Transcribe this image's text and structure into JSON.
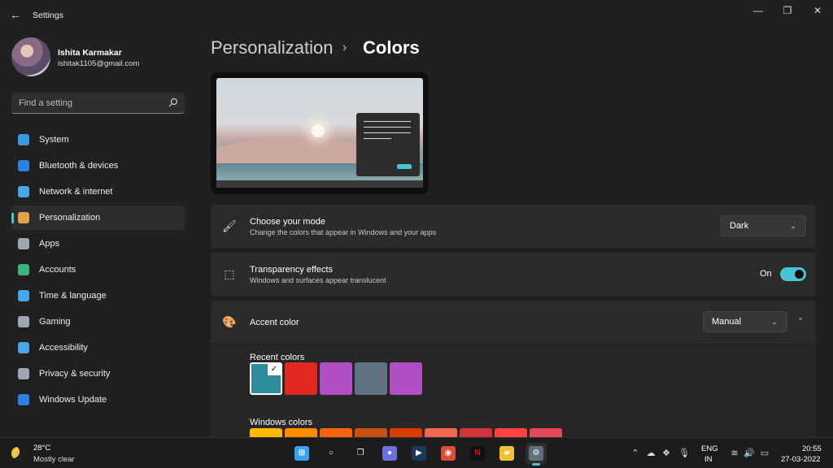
{
  "window": {
    "app_title": "Settings",
    "back_icon": "back-arrow-icon",
    "minimize_icon": "minimize-icon",
    "maximize_icon": "restore-icon",
    "close_icon": "close-icon"
  },
  "profile": {
    "name": "Ishita Karmakar",
    "email": "ishitak1105@gmail.com"
  },
  "search": {
    "placeholder": "Find a setting",
    "icon": "search-icon"
  },
  "sidebar": {
    "items": [
      {
        "label": "System",
        "icon": "system-icon",
        "color": "#3a9ae0",
        "active": false
      },
      {
        "label": "Bluetooth & devices",
        "icon": "bluetooth-icon",
        "color": "#2d7fe0",
        "active": false
      },
      {
        "label": "Network & internet",
        "icon": "wifi-icon",
        "color": "#4aa6e8",
        "active": false
      },
      {
        "label": "Personalization",
        "icon": "brush-icon",
        "color": "#e0a24a",
        "active": true
      },
      {
        "label": "Apps",
        "icon": "apps-icon",
        "color": "#9ea8b4",
        "active": false
      },
      {
        "label": "Accounts",
        "icon": "accounts-icon",
        "color": "#3fb37e",
        "active": false
      },
      {
        "label": "Time & language",
        "icon": "globe-clock-icon",
        "color": "#4aa6e8",
        "active": false
      },
      {
        "label": "Gaming",
        "icon": "gamepad-icon",
        "color": "#9ea8b4",
        "active": false
      },
      {
        "label": "Accessibility",
        "icon": "accessibility-icon",
        "color": "#4aa6e8",
        "active": false
      },
      {
        "label": "Privacy & security",
        "icon": "shield-icon",
        "color": "#9ea8b4",
        "active": false
      },
      {
        "label": "Windows Update",
        "icon": "update-icon",
        "color": "#2d7fe0",
        "active": false
      }
    ]
  },
  "breadcrumb": {
    "parent": "Personalization",
    "separator": "›",
    "current": "Colors"
  },
  "mode_card": {
    "title": "Choose your mode",
    "subtitle": "Change the colors that appear in Windows and your apps",
    "icon": "brush-icon",
    "dropdown_value": "Dark"
  },
  "transparency_card": {
    "title": "Transparency effects",
    "subtitle": "Windows and surfaces appear translucent",
    "icon": "transparency-icon",
    "toggle_label": "On",
    "toggle_on": true
  },
  "accent_card": {
    "title": "Accent color",
    "icon": "palette-icon",
    "dropdown_value": "Manual",
    "collapse_icon": "chevron-up-icon",
    "recent_label": "Recent colors",
    "recent_colors": [
      "#2d8d9b",
      "#e0281e",
      "#b04fc4",
      "#5f7381",
      "#b04fc4"
    ],
    "selected_index": 0,
    "windows_label": "Windows colors",
    "windows_colors": [
      "#ffb900",
      "#ff8c00",
      "#f7630c",
      "#ca5010",
      "#da3b01",
      "#ef6950",
      "#d13438",
      "#ff4343",
      "#e74856"
    ]
  },
  "taskbar": {
    "temperature": "28°C",
    "condition": "Mostly clear",
    "apps": [
      {
        "name": "start-icon",
        "glyph": "⊞",
        "color": "#3aa0f0"
      },
      {
        "name": "search-icon",
        "glyph": "○",
        "color": "#1c1c1c"
      },
      {
        "name": "task-view-icon",
        "glyph": "❐",
        "color": "#1c1c1c"
      },
      {
        "name": "teams-chat-icon",
        "glyph": "●",
        "color": "#6c6fe0"
      },
      {
        "name": "prime-video-icon",
        "glyph": "▶",
        "color": "#1a3a5a"
      },
      {
        "name": "chrome-icon",
        "glyph": "◉",
        "color": "#e04a3a"
      },
      {
        "name": "netflix-icon",
        "glyph": "N",
        "color": "#111111"
      },
      {
        "name": "file-explorer-icon",
        "glyph": "▰",
        "color": "#f2c230"
      },
      {
        "name": "settings-icon",
        "glyph": "⚙",
        "color": "#5f6f7f"
      }
    ],
    "tray": [
      "chevron-up-icon",
      "onedrive-icon",
      "dropbox-icon",
      "microphone-icon"
    ],
    "lang1": "ENG",
    "lang2": "IN",
    "status": [
      "wifi-icon",
      "volume-icon",
      "battery-icon"
    ],
    "time": "20:55",
    "date": "27-03-2022"
  }
}
